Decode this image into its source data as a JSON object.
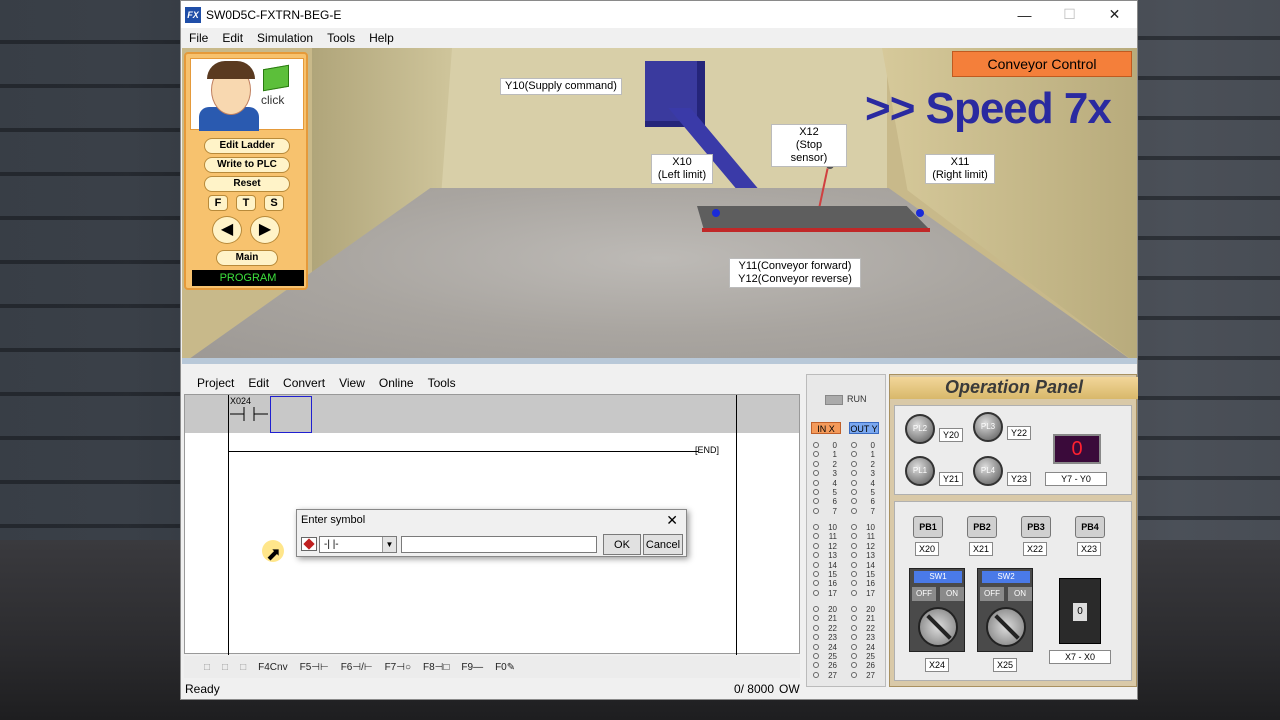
{
  "window": {
    "title": "SW0D5C-FXTRN-BEG-E",
    "app_icon": "fx-icon"
  },
  "menu": [
    "File",
    "Edit",
    "Simulation",
    "Tools",
    "Help"
  ],
  "scene": {
    "conveyor_control": "Conveyor Control",
    "speed": ">> Speed 7x",
    "labels": {
      "supply": "Y10(Supply command)",
      "stop_sensor_1": "X12",
      "stop_sensor_2": "(Stop sensor)",
      "left_1": "X10",
      "left_2": "(Left limit)",
      "right_1": "X11",
      "right_2": "(Right limit)",
      "conv_1": "Y11(Conveyor forward)",
      "conv_2": "Y12(Conveyor reverse)"
    }
  },
  "tutor": {
    "click": "click",
    "buttons": [
      "Edit Ladder",
      "Write to PLC",
      "Reset"
    ],
    "fts": [
      "F",
      "T",
      "S"
    ],
    "main": "Main",
    "mode": "PROGRAM"
  },
  "editor": {
    "menu": [
      "Project",
      "Edit",
      "Convert",
      "View",
      "Online",
      "Tools"
    ],
    "contact_label": "X024",
    "end": "END",
    "toolbar": [
      "F5",
      "sF5",
      "F6",
      "F4Cnv",
      "F5",
      "F6",
      "F7",
      "F8",
      "F9",
      "F0"
    ],
    "toolbar_labels": [
      "",
      "",
      "",
      "F4Cnv",
      "F5⊣⊢",
      "F6⊣/⊢",
      "F7⊣○",
      "F8⊣□",
      "F9—",
      "F0"
    ]
  },
  "status": {
    "ready": "Ready",
    "steps": "0/ 8000",
    "mode": "OW"
  },
  "io": {
    "run": "RUN",
    "in_header": "IN X",
    "out_header": "OUT Y",
    "groups": [
      [
        "0",
        "1",
        "2",
        "3",
        "4",
        "5",
        "6",
        "7"
      ],
      [
        "10",
        "11",
        "12",
        "13",
        "14",
        "15",
        "16",
        "17"
      ],
      [
        "20",
        "21",
        "22",
        "23",
        "24",
        "25",
        "26",
        "27"
      ]
    ]
  },
  "operation_panel": {
    "title": "Operation Panel",
    "pilot_lamps": [
      {
        "name": "PL2",
        "addr": "Y20"
      },
      {
        "name": "PL3",
        "addr": "Y22"
      },
      {
        "name": "PL1",
        "addr": "Y21"
      },
      {
        "name": "PL4",
        "addr": "Y23"
      }
    ],
    "seven_seg": {
      "value": "0",
      "label": "Y7 - Y0"
    },
    "push_buttons": [
      {
        "name": "PB1",
        "addr": "X20"
      },
      {
        "name": "PB2",
        "addr": "X21"
      },
      {
        "name": "PB3",
        "addr": "X22"
      },
      {
        "name": "PB4",
        "addr": "X23"
      }
    ],
    "switches": [
      {
        "name": "SW1",
        "off": "OFF",
        "on": "ON",
        "addr": "X24"
      },
      {
        "name": "SW2",
        "off": "OFF",
        "on": "ON",
        "addr": "X25"
      }
    ],
    "thumbwheel": {
      "value": "0",
      "label": "X7 - X0"
    }
  },
  "dialog": {
    "title": "Enter symbol",
    "select_value": "-| |-",
    "input_value": "",
    "ok": "OK",
    "cancel": "Cancel"
  }
}
